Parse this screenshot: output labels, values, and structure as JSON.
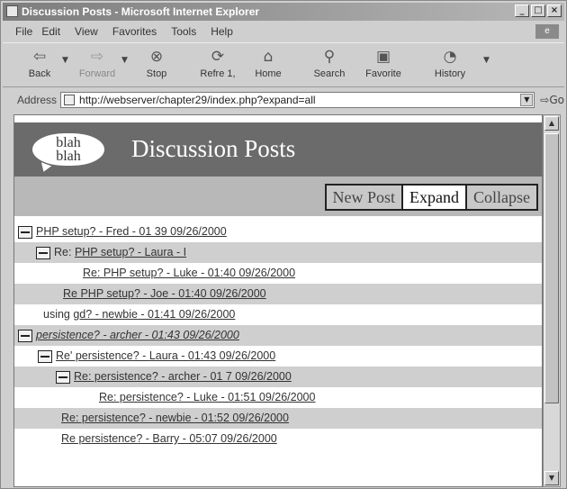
{
  "window": {
    "title": "Discussion Posts - Microsoft Internet Explorer",
    "buttons": [
      "_",
      "□",
      "×"
    ]
  },
  "menu": [
    "File",
    "Edit",
    "View",
    "Favorites",
    "Tools",
    "Help"
  ],
  "toolbar": {
    "back": "Back",
    "forward": "Forward",
    "stop": "Stop",
    "refresh": "Refre 1,",
    "home": "Home",
    "search": "Search",
    "favorites": "Favorite",
    "history": "History"
  },
  "address": {
    "label": "Address",
    "url": "http://webserver/chapter29/index.php?expand=all",
    "go": "Go"
  },
  "page": {
    "logo_line1": "blah",
    "logo_line2": "blah",
    "heading": "Discussion Posts",
    "actions": {
      "new_post": "New Post",
      "expand": "Expand",
      "collapse": "Collapse"
    }
  },
  "posts": [
    {
      "text": "PHP setup? - Fred - 01 39 09/26/2000"
    },
    {
      "prefix": "Re: ",
      "text": "PHP setup? - Laura - I"
    },
    {
      "text": "Re: PHP setup? - Luke - 01:40 09/26/2000"
    },
    {
      "text": "Re PHP setup? - Joe - 01:40 09/26/2000"
    },
    {
      "prefix": "using ",
      "text": "gd? - newbie - 01:41 09/26/2000"
    },
    {
      "text": "persistence? - archer - 01:43 09/26/2000"
    },
    {
      "text": "Re' persistence? - Laura - 01:43 09/26/2000"
    },
    {
      "text": "Re: persistence? - archer - 01 7 09/26/2000"
    },
    {
      "text": "Re: persistence? - Luke - 01:51 09/26/2000"
    },
    {
      "text": "Re: persistence? - newbie - 01:52 09/26/2000"
    },
    {
      "text": "Re persistence? - Barry - 05:07 09/26/2000"
    }
  ]
}
